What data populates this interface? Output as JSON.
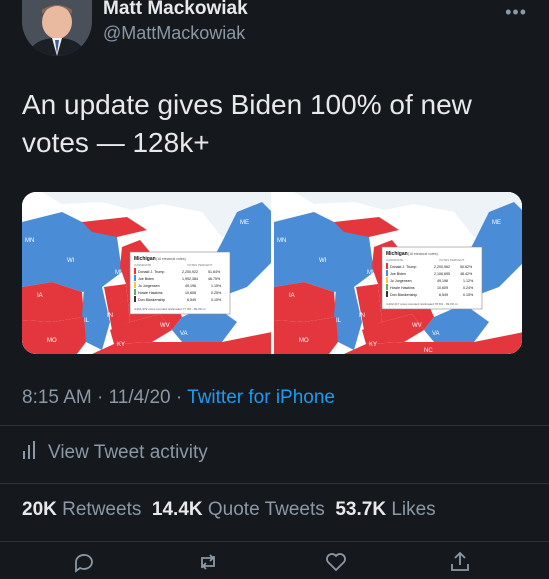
{
  "author": {
    "name": "Matt Mackowiak",
    "handle": "@MattMackowiak"
  },
  "tweet": {
    "text": "An update gives Biden 100% of new votes — 128k+"
  },
  "media": {
    "panels": [
      {
        "state_labels": [
          "MN",
          "WI",
          "MI",
          "IA",
          "IL",
          "IN",
          "MO",
          "KY",
          "WV",
          "VA",
          "ME"
        ],
        "info_box": {
          "title": "Michigan",
          "subtitle": "(16 electoral votes)",
          "columns": [
            "CANDIDATE",
            "VOTES",
            "PERCENT"
          ],
          "rows": [
            {
              "candidate": "Donald J. Trump",
              "votes": "2,200,922",
              "percent": "51.64%",
              "color": "#e3373d"
            },
            {
              "candidate": "Joe Biden",
              "votes": "1,992,384",
              "percent": "46.75%",
              "color": "#4b8cd6"
            },
            {
              "candidate": "Jo Jorgensen",
              "votes": "49,196",
              "percent": "1.15%",
              "color": "#f2c84b"
            },
            {
              "candidate": "Howie Hawkins",
              "votes": "10,608",
              "percent": "0.25%",
              "color": "#5bb35b"
            },
            {
              "candidate": "Don Blankenship",
              "votes": "6,549",
              "percent": "0.15%",
              "color": "#333333"
            }
          ],
          "footer": "4,261,979 votes counted. Estimated 77.3% - 90.0% in"
        }
      },
      {
        "state_labels": [
          "MN",
          "WI",
          "MI",
          "IA",
          "IL",
          "IN",
          "MO",
          "KY",
          "WV",
          "VA",
          "ME",
          "NC"
        ],
        "info_box": {
          "title": "Michigan",
          "subtitle": "(16 electoral votes)",
          "columns": [
            "CANDIDATE",
            "VOTES",
            "PERCENT"
          ],
          "rows": [
            {
              "candidate": "Donald J. Trump",
              "votes": "2,200,962",
              "percent": "50.62%",
              "color": "#e3373d"
            },
            {
              "candidate": "Joe Biden",
              "votes": "2,106,695",
              "percent": "48.42%",
              "color": "#4b8cd6"
            },
            {
              "candidate": "Jo Jorgensen",
              "votes": "49,196",
              "percent": "1.12%",
              "color": "#f2c84b"
            },
            {
              "candidate": "Howie Hawkins",
              "votes": "10,609",
              "percent": "0.24%",
              "color": "#5bb35b"
            },
            {
              "candidate": "Don Blankenship",
              "votes": "6,549",
              "percent": "0.15%",
              "color": "#333333"
            }
          ],
          "footer": "4,402,217 votes counted. Estimated 78.6% - 93.0% in"
        }
      }
    ]
  },
  "meta": {
    "time": "8:15 AM",
    "separator": " · ",
    "date": "11/4/20",
    "source": "Twitter for iPhone"
  },
  "activity": {
    "label": "View Tweet activity",
    "icon": "bar-chart-icon"
  },
  "stats": {
    "retweets_count": "20K",
    "retweets_label": "Retweets",
    "quotes_count": "14.4K",
    "quotes_label": "Quote Tweets",
    "likes_count": "53.7K",
    "likes_label": "Likes"
  },
  "actions": {
    "icons": [
      "reply-icon",
      "retweet-icon",
      "like-icon",
      "share-icon"
    ]
  },
  "colors": {
    "background": "#15181d",
    "text": "#e7e9ea",
    "secondary": "#8b98a5",
    "link": "#1d9bf0",
    "republican": "#e3373d",
    "democrat": "#4b8cd6"
  }
}
